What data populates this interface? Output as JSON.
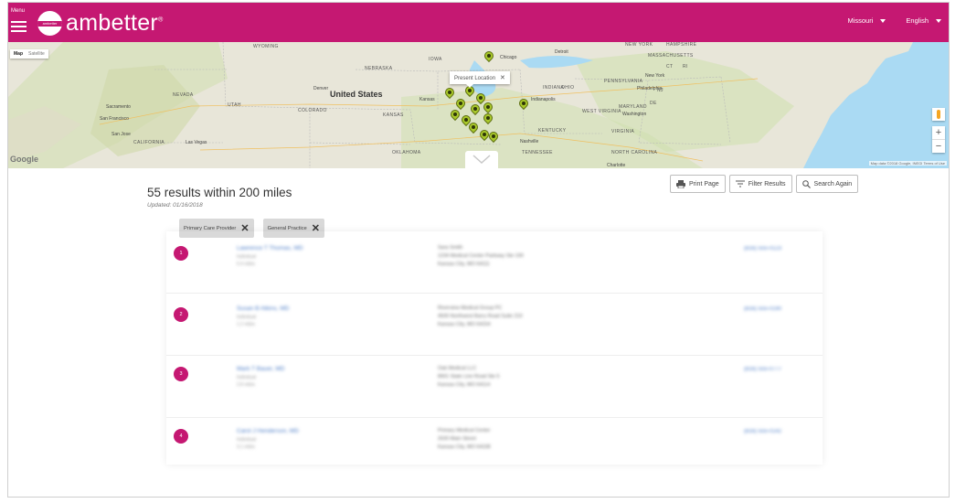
{
  "header": {
    "menu_label": "Menu",
    "brand": "ambetter",
    "brand_mark_text": "ambetter",
    "state": "Missouri",
    "language": "English",
    "brand_color": "#c51872"
  },
  "map": {
    "type_map": "Map",
    "type_satellite": "Satellite",
    "country": "United States",
    "popup_text": "Present Location",
    "google": "Google",
    "footer": "Map data ©2018 Google, INEGI   Terms of Use",
    "zoom_in": "+",
    "zoom_out": "−",
    "labels": {
      "wyoming": "WYOMING",
      "nebraska": "NEBRASKA",
      "iowa": "IOWA",
      "nevada": "NEVADA",
      "utah": "UTAH",
      "colorado": "COLORADO",
      "kansas": "KANSAS",
      "oklahoma": "OKLAHOMA",
      "california": "CALIFORNIA",
      "indiana": "INDIANA",
      "ohio": "OHIO",
      "pennsylvania": "PENNSYLVANIA",
      "kentucky": "KENTUCKY",
      "tennessee": "TENNESSEE",
      "virginia": "VIRGINIA",
      "west_virginia": "WEST VIRGINIA",
      "maryland": "MARYLAND",
      "north_carolina": "NORTH CAROLINA",
      "massachusetts": "MASSACHUSETTS",
      "new_hampshire": "HAMPSHIRE",
      "new_york_state": "NEW YORK",
      "denver": "Denver",
      "sacramento": "Sacramento",
      "san_francisco": "San Francisco",
      "san_jose": "San Jose",
      "las_vegas": "Las Vegas",
      "chicago": "Chicago",
      "detroit": "Detroit",
      "kansas_city": "Kansas",
      "nashville": "Nashville",
      "indianapolis": "Indianapolis",
      "philadelphia": "Philadelphia",
      "new_york": "New York",
      "washington": "Washington",
      "charlotte": "Charlotte",
      "ct": "CT",
      "ri": "RI",
      "nj": "NJ",
      "de": "DE"
    }
  },
  "results": {
    "title": "55 results within 200 miles",
    "updated": "Updated: 01/16/2018",
    "print_label": "Print Page",
    "filter_label": "Filter Results",
    "search_label": "Search Again",
    "chips": [
      {
        "label": "Primary Care Provider",
        "remove": "✕"
      },
      {
        "label": "General Practice",
        "remove": "✕"
      }
    ],
    "rows": [
      {
        "num": "1",
        "name": "Lawrence T Thomas, MD",
        "sub1": "Individual",
        "sub2": "0.4 miles",
        "addr1": "Sara Smith",
        "addr2": "1234 Medical Center Parkway Ste 100",
        "addr3": "Kansas City, MO 64111",
        "addr4": "",
        "phone": "(816) 555-0123"
      },
      {
        "num": "2",
        "name": "Susan B Atkins, MD",
        "sub1": "Individual",
        "sub2": "1.2 miles",
        "addr1": "Riverview Medical Group PC",
        "addr2": "4500 Northwest Barry Road Suite 210",
        "addr3": "Kansas City, MO 64154",
        "addr4": "",
        "phone": "(816) 555-0190"
      },
      {
        "num": "3",
        "name": "Mark T Bauer, MD",
        "sub1": "Individual",
        "sub2": "2.8 miles",
        "addr1": "Oak Medical LLC",
        "addr2": "8901 State Line Road Ste 5",
        "addr3": "Kansas City, MO 64114",
        "addr4": "",
        "phone": "(816) 555-0777"
      },
      {
        "num": "4",
        "name": "Carol J Henderson, MD",
        "sub1": "Individual",
        "sub2": "3.1 miles",
        "addr1": "Primary Medical Center",
        "addr2": "2020 Main Street",
        "addr3": "Kansas City, MO 64108",
        "addr4": "",
        "phone": "(816) 555-0142"
      }
    ]
  }
}
